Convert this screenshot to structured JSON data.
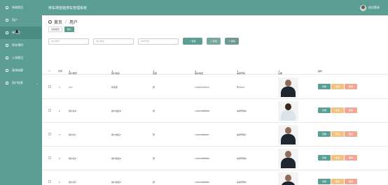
{
  "app": {
    "title": "停车场智能停车管理系统",
    "logout": "退出登录"
  },
  "sidebar": {
    "items": [
      {
        "label": "系统首页",
        "icon": "home-icon"
      },
      {
        "label": "用户",
        "icon": "user-icon"
      },
      {
        "label": "停车位",
        "icon": "parking-icon"
      },
      {
        "label": "停车预约",
        "icon": "calendar-icon"
      },
      {
        "label": "入场登记",
        "icon": "entry-icon"
      },
      {
        "label": "离场结算",
        "icon": "exit-icon"
      },
      {
        "label": "用户检索",
        "icon": "search-icon"
      }
    ]
  },
  "breadcrumb": {
    "home": "首页",
    "current": "用户"
  },
  "tags": [
    "系统首页",
    "用户"
  ],
  "search": {
    "account_placeholder": "用户账号",
    "name_placeholder": "用户姓名",
    "plate_placeholder": "车牌号码",
    "query": "查询",
    "add": "新增",
    "delete": "删除"
  },
  "table": {
    "headers": [
      "序号",
      "用户账号",
      "用户姓名",
      "性别",
      "联系电话",
      "车牌号码",
      "头像",
      "操作"
    ],
    "rows": [
      {
        "idx": "1",
        "account": "111",
        "name": "张海燕",
        "gender": "男",
        "phone": "13012314512",
        "plate": "粤A003",
        "photo": "m"
      },
      {
        "idx": "2",
        "account": "用户名8",
        "name": "用户姓名8",
        "gender": "男",
        "phone": "13823888888",
        "plate": "车牌号码8",
        "photo": "f"
      },
      {
        "idx": "3",
        "account": "用户名7",
        "name": "用户姓名7",
        "gender": "男",
        "phone": "13823888887",
        "plate": "车牌号码7",
        "photo": "m"
      },
      {
        "idx": "4",
        "account": "用户名6",
        "name": "用户姓名6",
        "gender": "男",
        "phone": "13823888886",
        "plate": "车牌号码6",
        "photo": "m"
      },
      {
        "idx": "5",
        "account": "用户名5",
        "name": "用户姓名5",
        "gender": "男",
        "phone": "13823888885",
        "plate": "车牌号码5",
        "photo": "m"
      }
    ],
    "actions": {
      "view": "查看",
      "edit": "修改",
      "remove": "删除"
    }
  },
  "colors": {
    "brand": "#5c9e93",
    "edit": "#f1c382",
    "remove": "#f0a894"
  }
}
